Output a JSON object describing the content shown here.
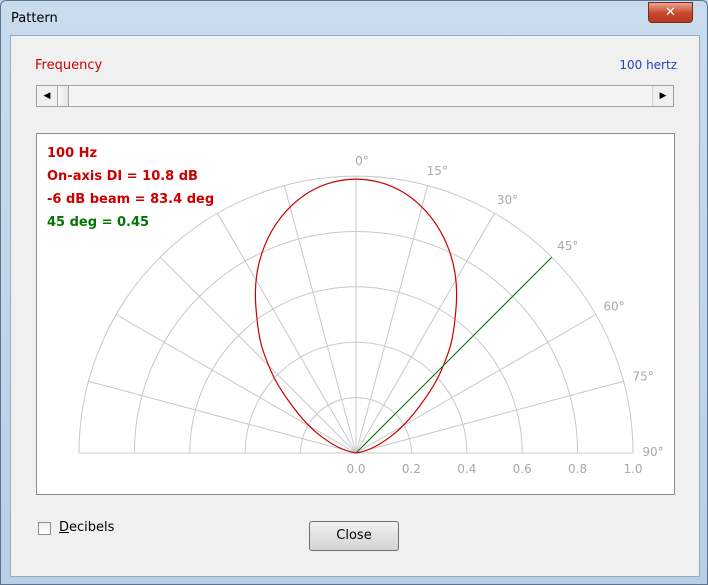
{
  "window": {
    "title": "Pattern",
    "close_glyph": "✕"
  },
  "frequency": {
    "label": "Frequency",
    "value": "100 hertz"
  },
  "slider": {
    "left_arrow": "◀",
    "right_arrow": "▶",
    "position": 0.01
  },
  "plot": {
    "info": {
      "freq": "100 Hz",
      "di": "On-axis DI = 10.8 dB",
      "beam": "-6 dB beam = 83.4 deg",
      "angle_value": "45 deg = 0.45"
    },
    "angle_labels": [
      "0°",
      "15°",
      "30°",
      "45°",
      "60°",
      "75°",
      "90°"
    ],
    "radial_labels": [
      "0.0",
      "0.2",
      "0.4",
      "0.6",
      "0.8",
      "1.0"
    ],
    "colors": {
      "info": "#cc0000",
      "angle_value": "#007700",
      "curve": "#cc0000",
      "marker": "#007700",
      "grid": "#c8c8c8",
      "labels": "#a8a8a8"
    }
  },
  "chart_data": {
    "type": "polar",
    "angle_unit": "deg",
    "radius_range": [
      0,
      1.0
    ],
    "theta_range": [
      0,
      90
    ],
    "angle_ticks": [
      0,
      15,
      30,
      45,
      60,
      75,
      90
    ],
    "radial_ticks": [
      0.0,
      0.2,
      0.4,
      0.6,
      0.8,
      1.0
    ],
    "grid": true,
    "series": [
      {
        "values_theta": [
          0,
          10,
          20,
          30,
          40,
          45,
          50,
          60,
          70,
          80,
          90
        ],
        "values_r": [
          1.0,
          0.97,
          0.88,
          0.74,
          0.55,
          0.45,
          0.36,
          0.21,
          0.1,
          0.03,
          0.0
        ]
      }
    ],
    "marker": {
      "theta": 45,
      "r": 1.0
    }
  },
  "decibels": {
    "label_mnemonic": "D",
    "label_rest": "ecibels",
    "checked": false
  },
  "buttons": {
    "close": "Close"
  }
}
